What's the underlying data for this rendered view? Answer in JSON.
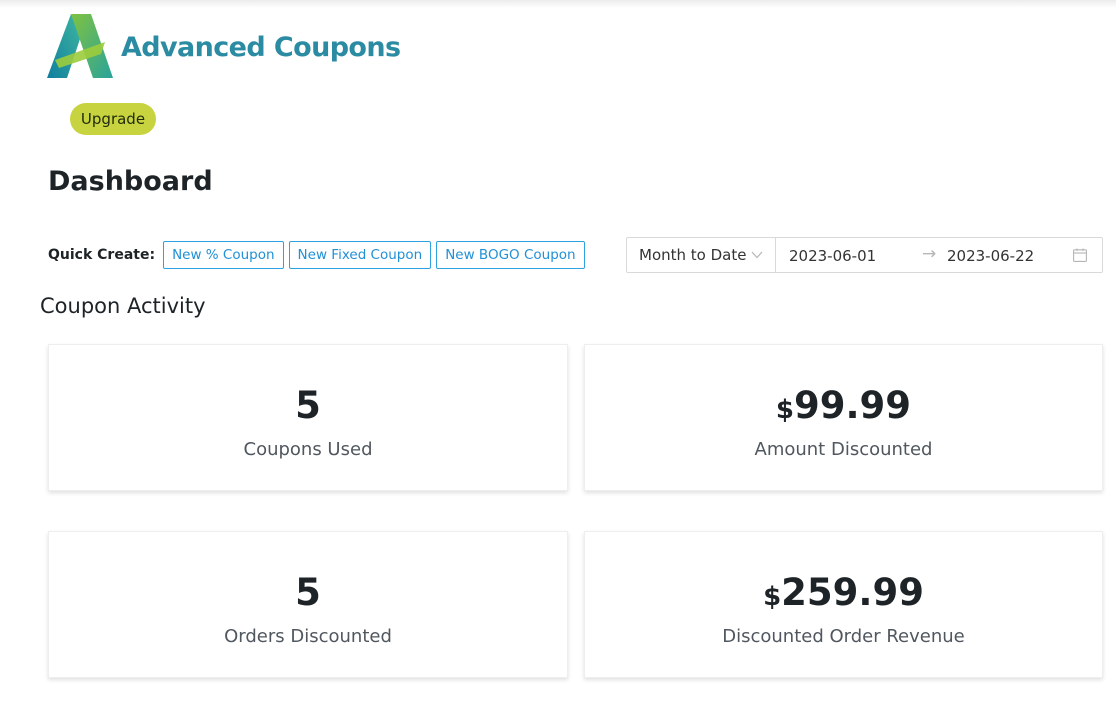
{
  "brand": {
    "name": "Advanced Coupons",
    "logo_icon": "advanced-coupons-logo-icon",
    "color": "#2b8ba2"
  },
  "header": {
    "upgrade_label": "Upgrade",
    "upgrade_color": "#c8d43f"
  },
  "page": {
    "title": "Dashboard"
  },
  "quick_create": {
    "label": "Quick Create:",
    "buttons": [
      "New % Coupon",
      "New Fixed Coupon",
      "New BOGO Coupon"
    ],
    "accent_color": "#2190d6"
  },
  "date_filter": {
    "range_value": "Month to Date",
    "start_date": "2023-06-01",
    "separator": "→",
    "end_date": "2023-06-22",
    "icons": [
      "chevron-down-icon",
      "calendar-icon"
    ]
  },
  "coupon_activity": {
    "title": "Coupon Activity",
    "cards": [
      {
        "currency": "",
        "value": "5",
        "label": "Coupons Used"
      },
      {
        "currency": "$",
        "value": "99.99",
        "label": "Amount Discounted"
      },
      {
        "currency": "",
        "value": "5",
        "label": "Orders Discounted"
      },
      {
        "currency": "$",
        "value": "259.99",
        "label": "Discounted Order Revenue"
      }
    ]
  }
}
